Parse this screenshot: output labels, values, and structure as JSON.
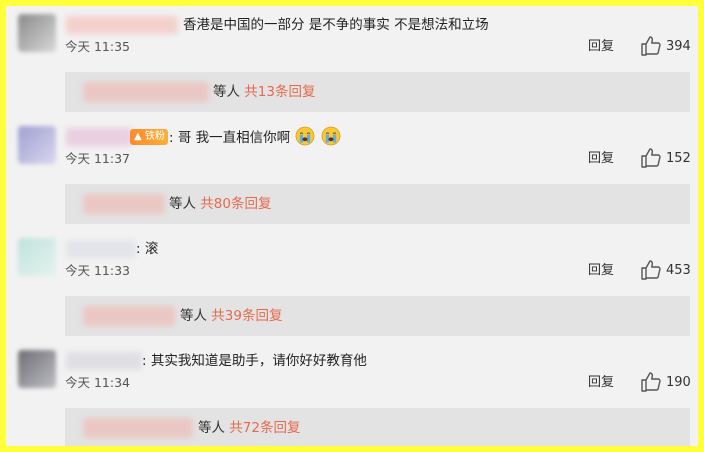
{
  "comments": [
    {
      "text": "香港是中国的一部分 是不争的事实 不是想法和立场",
      "time": "今天 11:35",
      "reply_label": "回复",
      "likes": "394",
      "sub_names": "等人",
      "sub_count": "共13条回复"
    },
    {
      "text": ": 哥 我一直相信你啊",
      "badge": "铁粉",
      "time": "今天 11:37",
      "reply_label": "回复",
      "likes": "152",
      "sub_names": "等人",
      "sub_count": "共80条回复"
    },
    {
      "text": ": 滚",
      "time": "今天 11:33",
      "reply_label": "回复",
      "likes": "453",
      "sub_names": "等人",
      "sub_count": "共39条回复"
    },
    {
      "text": ": 其实我知道是助手，请你好好教育他",
      "time": "今天 11:34",
      "reply_label": "回复",
      "likes": "190",
      "sub_names": "等人",
      "sub_count": "共72条回复"
    }
  ],
  "icons": {
    "like": "thumbs-up-icon",
    "emoji": "crying-face-icon",
    "badge": "fire-icon"
  },
  "colors": {
    "frame_border": "#ffff3a",
    "background": "#f2f2f2",
    "sub_background": "#e3e3e3",
    "reply_count": "#e46a4e"
  }
}
